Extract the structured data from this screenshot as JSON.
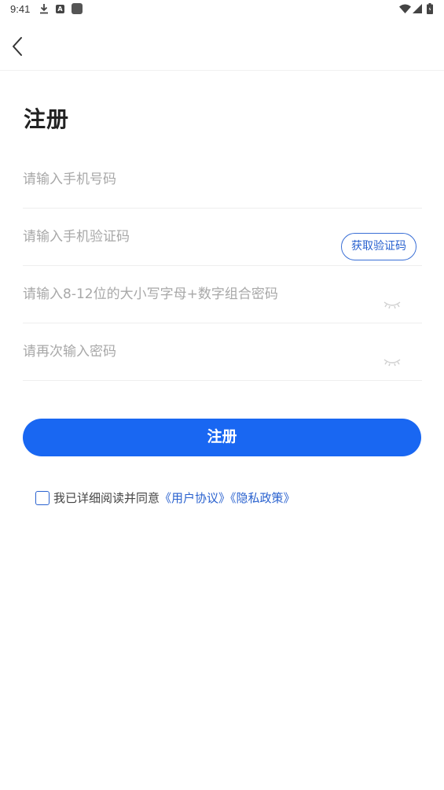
{
  "status_bar": {
    "time": "9:41",
    "icons": [
      "download-icon",
      "a-notification-icon",
      "square-notification-icon",
      "wifi-icon",
      "signal-icon",
      "battery-icon"
    ]
  },
  "nav": {
    "back_icon": "chevron-left-icon"
  },
  "title": "注册",
  "fields": {
    "phone": {
      "placeholder": "请输入手机号码",
      "value": ""
    },
    "code": {
      "placeholder": "请输入手机验证码",
      "value": "",
      "button_label": "获取验证码"
    },
    "password": {
      "placeholder": "请输入8-12位的大小写字母+数字组合密码",
      "value": "",
      "toggle_icon": "eye-closed-icon"
    },
    "password_confirm": {
      "placeholder": "请再次输入密码",
      "value": "",
      "toggle_icon": "eye-closed-icon"
    }
  },
  "submit_label": "注册",
  "agreement": {
    "checked": false,
    "text": "我已详细阅读并同意",
    "user_agreement": "《用户协议》",
    "privacy_policy": "《隐私政策》"
  },
  "colors": {
    "primary": "#1967f2",
    "link": "#2a62cf",
    "placeholder": "#a8a8a8"
  }
}
